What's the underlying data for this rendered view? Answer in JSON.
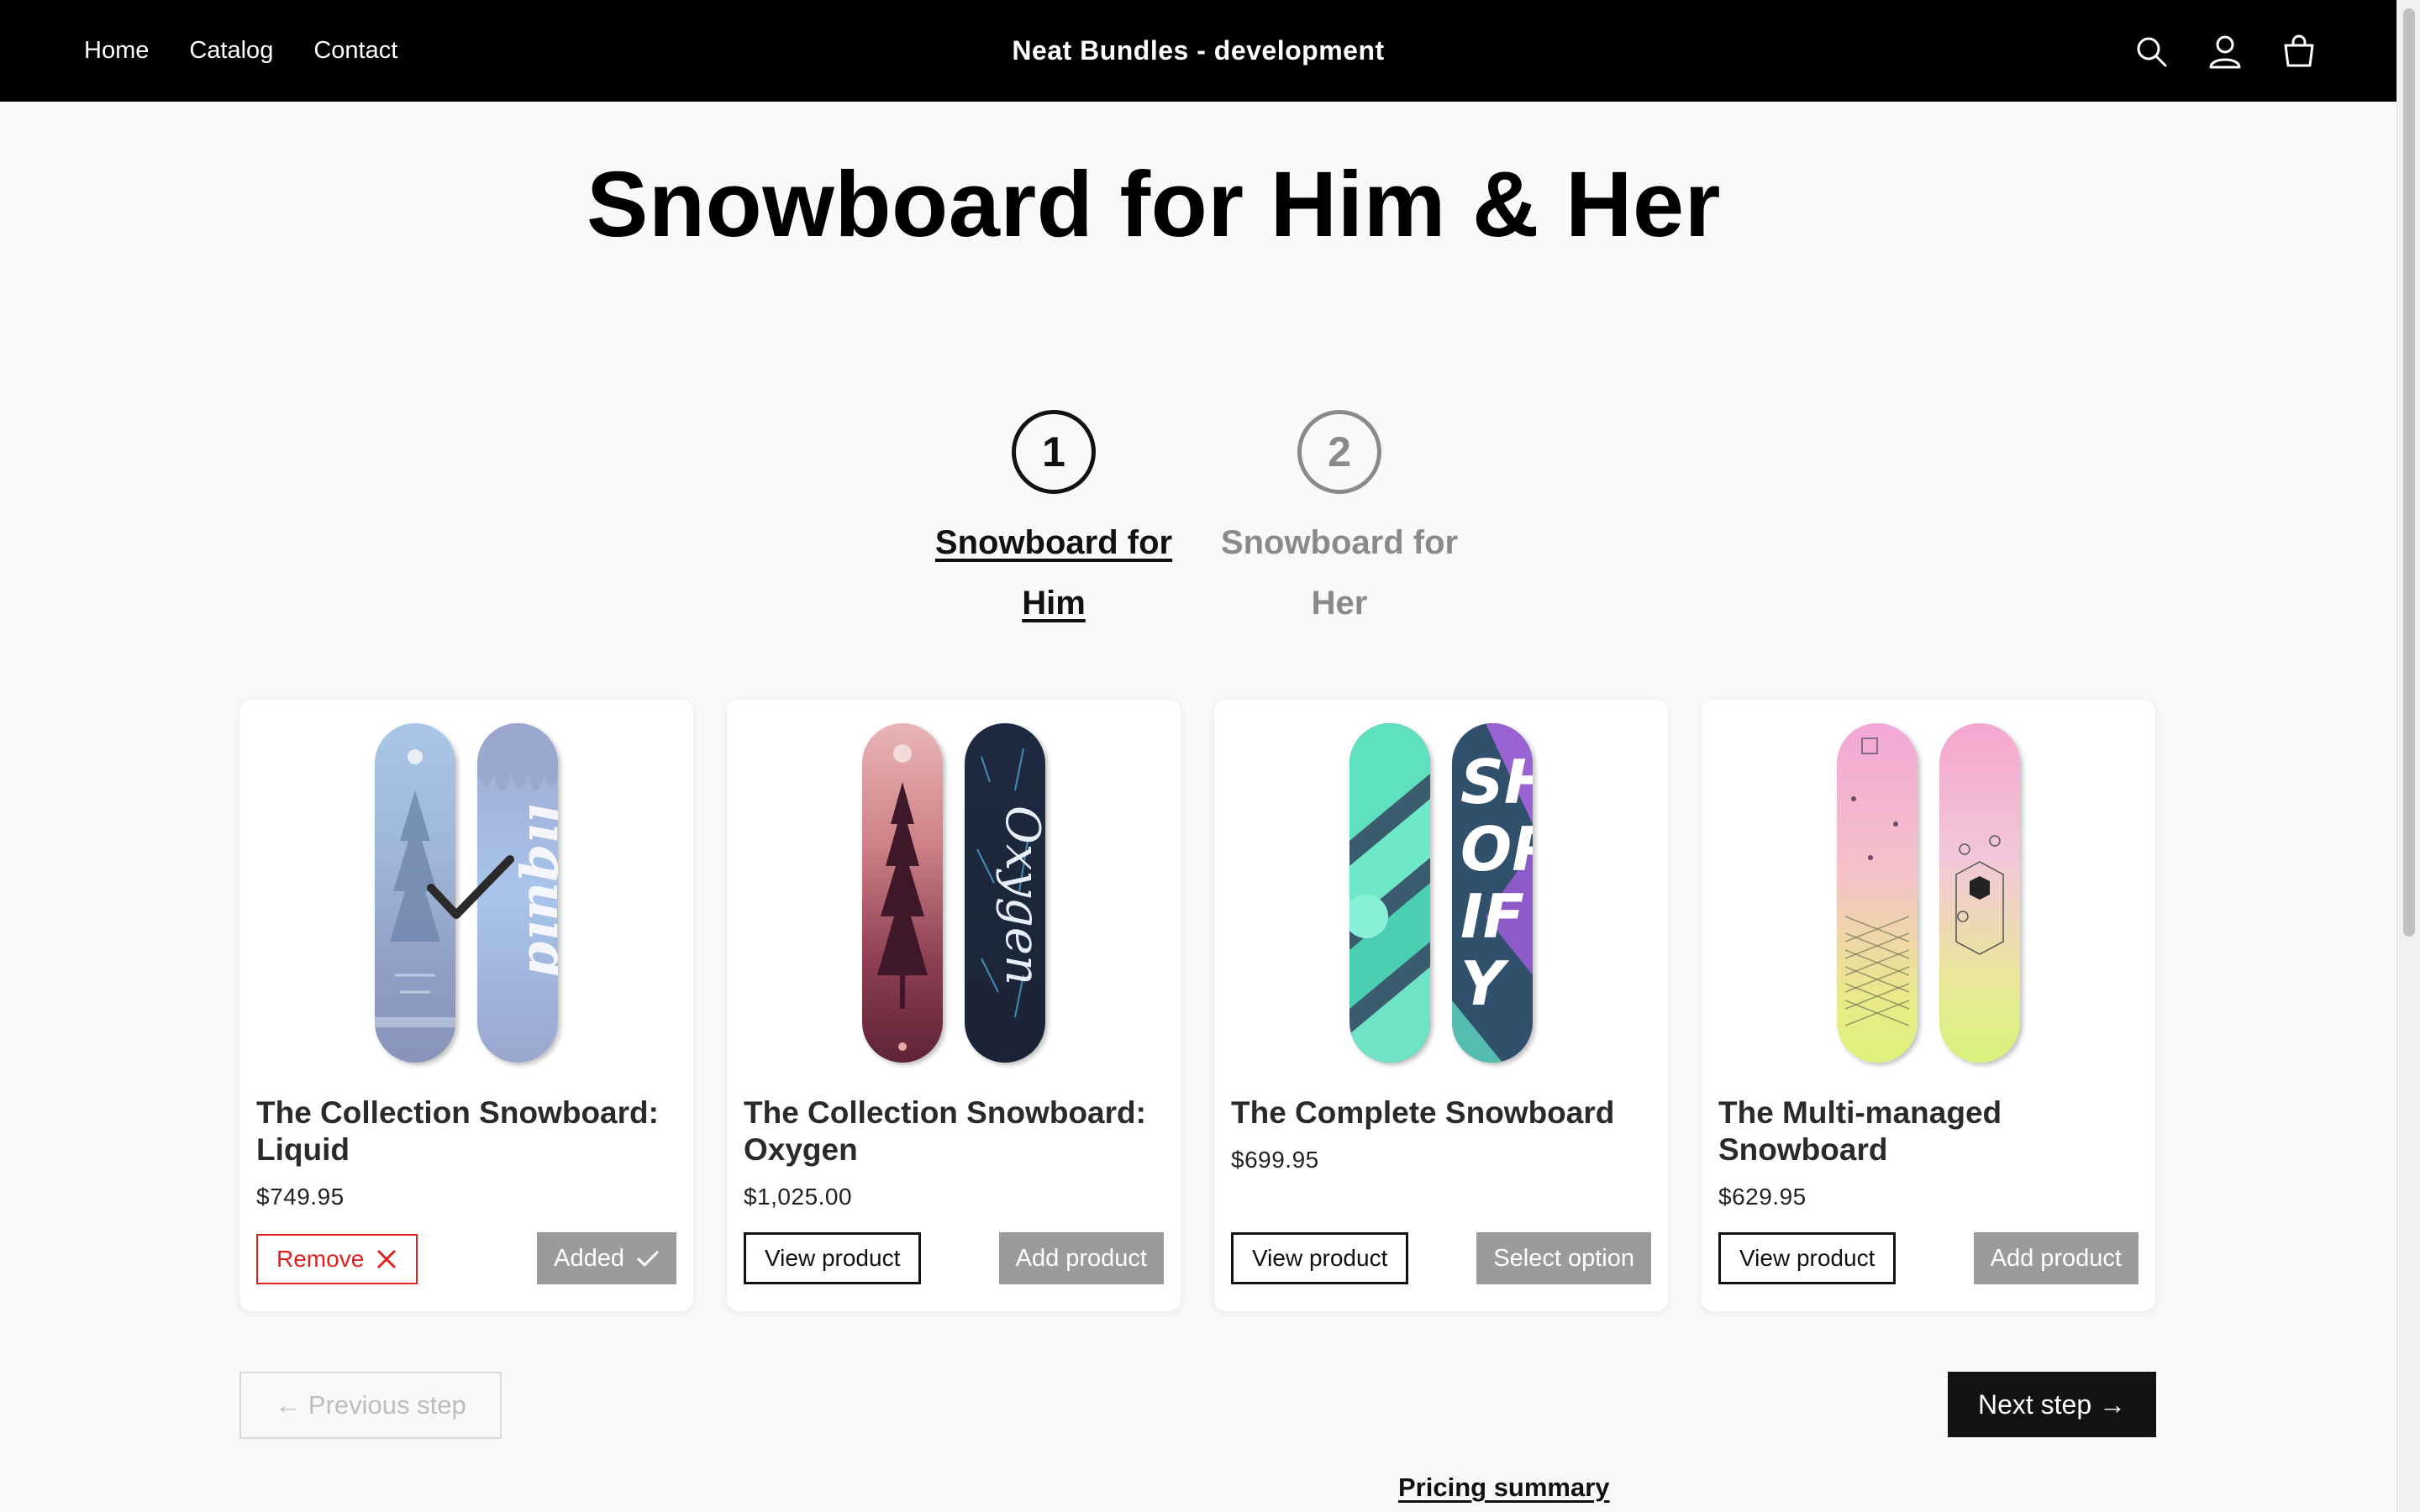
{
  "header": {
    "nav": [
      "Home",
      "Catalog",
      "Contact"
    ],
    "brand": "Neat Bundles - development",
    "icons": [
      "search-icon",
      "account-icon",
      "cart-icon"
    ]
  },
  "page": {
    "title": "Snowboard for Him & Her"
  },
  "steps": [
    {
      "number": "1",
      "label": "Snowboard for Him",
      "state": "active"
    },
    {
      "number": "2",
      "label": "Snowboard for Her",
      "state": "inactive"
    }
  ],
  "products": [
    {
      "name": "The Collection Snowboard: Liquid",
      "price": "$749.95",
      "selected": true,
      "remove_label": "Remove",
      "added_label": "Added"
    },
    {
      "name": "The Collection Snowboard: Oxygen",
      "price": "$1,025.00",
      "view_label": "View product",
      "action_label": "Add product"
    },
    {
      "name": "The Complete Snowboard",
      "price": "$699.95",
      "view_label": "View product",
      "action_label": "Select option"
    },
    {
      "name": "The Multi-managed Snowboard",
      "price": "$629.95",
      "view_label": "View product",
      "action_label": "Add product"
    }
  ],
  "navigation": {
    "prev_label": "← Previous step",
    "next_label": "Next step →"
  },
  "summary": {
    "label": "Pricing summary"
  },
  "colors": {
    "header_bg": "#000000",
    "remove_red": "#e0211f",
    "button_gray": "#9b9b9b",
    "inactive_step": "#8a8a8a"
  }
}
